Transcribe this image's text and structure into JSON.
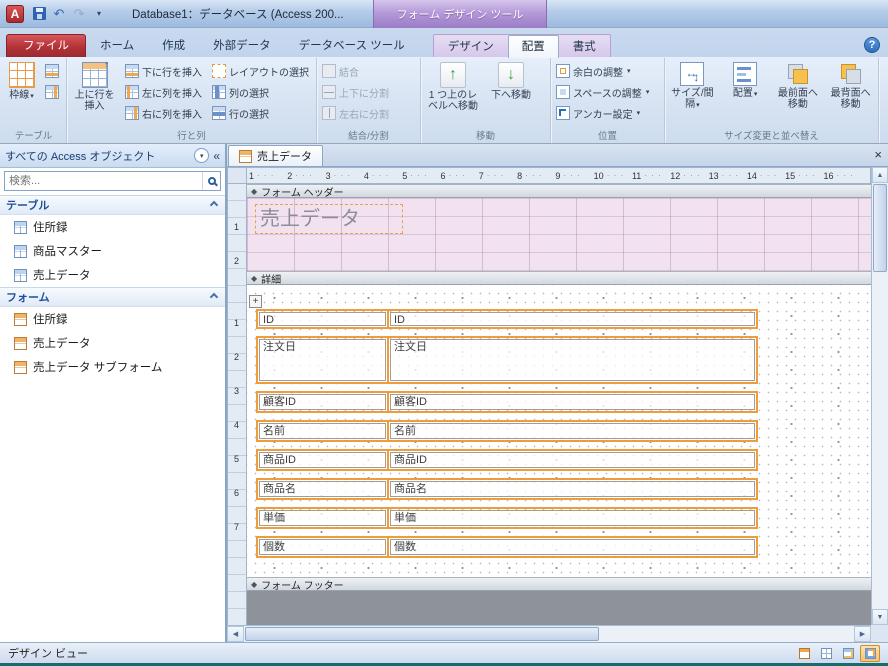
{
  "window": {
    "app_glyph": "A",
    "title": "Database1：データベース (Access 200...",
    "context_tool_tab": "フォーム デザイン ツール"
  },
  "icons": {
    "dropdown": "▾",
    "collapse": "«",
    "close": "×",
    "undo": "↶",
    "redo": "↷",
    "help": "?",
    "plus": "+",
    "diamond": "◆",
    "up": "▲",
    "down": "▼",
    "left": "◀",
    "right": "▶",
    "arrow_up": "↑",
    "arrow_down": "↓"
  },
  "tabs": {
    "file": "ファイル",
    "home": "ホーム",
    "create": "作成",
    "external": "外部データ",
    "dbtools": "データベース ツール",
    "design": "デザイン",
    "arrange": "配置",
    "format": "書式"
  },
  "ribbon": {
    "table_group": {
      "label": "テーブル",
      "gridlines": "枠線"
    },
    "rows_group": {
      "label": "行と列",
      "insert_above": "上に行を挿入",
      "insert_below": "下に行を挿入",
      "insert_left": "左に列を挿入",
      "insert_right": "右に列を挿入",
      "select_layout": "レイアウトの選択",
      "select_column": "列の選択",
      "select_row": "行の選択"
    },
    "merge_group": {
      "label": "結合/分割",
      "merge": "結合",
      "split_v": "上下に分割",
      "split_h": "左右に分割"
    },
    "move_group": {
      "label": "移動",
      "up": "1 つ上のレベルへ移動",
      "down": "下へ移動"
    },
    "position_group": {
      "label": "位置",
      "margins": "余白の調整",
      "spacing": "スペースの調整",
      "anchor": "アンカー設定"
    },
    "size_group": {
      "label": "サイズ変更と並べ替え",
      "size": "サイズ/間隔",
      "align": "配置",
      "front": "最前面へ移動",
      "back": "最背面へ移動"
    }
  },
  "nav": {
    "title": "すべての Access オブジェクト",
    "search_placeholder": "検索...",
    "sections": [
      {
        "label": "テーブル",
        "items": [
          "住所録",
          "商品マスター",
          "売上データ"
        ]
      },
      {
        "label": "フォーム",
        "items": [
          "住所録",
          "売上データ",
          "売上データ サブフォーム"
        ]
      }
    ]
  },
  "document": {
    "tab_label": "売上データ",
    "header_section": "フォーム ヘッダー",
    "detail_section": "詳細",
    "footer_section": "フォーム フッター",
    "header_title": "売上データ",
    "fields": [
      {
        "label": "ID",
        "text": "ID"
      },
      {
        "label": "注文日",
        "text": "注文日"
      },
      {
        "label": "顧客ID",
        "text": "顧客ID"
      },
      {
        "label": "名前",
        "text": "名前"
      },
      {
        "label": "商品ID",
        "text": "商品ID"
      },
      {
        "label": "商品名",
        "text": "商品名"
      },
      {
        "label": "単価",
        "text": "単価"
      },
      {
        "label": "個数",
        "text": "個数"
      }
    ],
    "ruler_h": [
      1,
      2,
      3,
      4,
      5,
      6,
      7,
      8,
      9,
      10,
      11,
      12,
      13,
      14,
      15,
      16
    ],
    "ruler_v_header": [
      1,
      2
    ],
    "ruler_v_detail": [
      1,
      2,
      3,
      4,
      5,
      6,
      7
    ]
  },
  "status": {
    "view_label": "デザイン ビュー"
  }
}
